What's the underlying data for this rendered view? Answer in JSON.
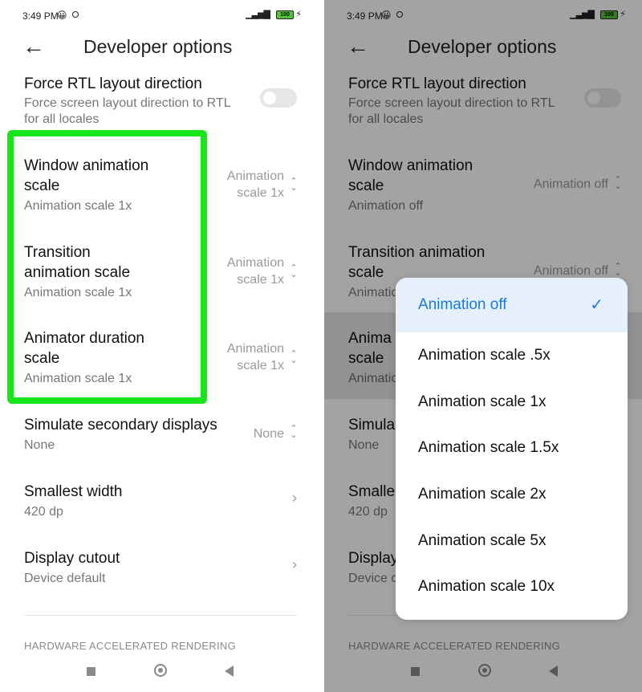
{
  "status": {
    "time": "3:49 PM",
    "battery": "100",
    "emoji": "😀"
  },
  "header": {
    "title": "Developer options",
    "back": "←"
  },
  "settings": {
    "rtl": {
      "title": "Force RTL layout direction",
      "subtitle_line1": "Force screen layout direction to RTL",
      "subtitle_line2": "for all locales"
    },
    "window": {
      "title_line1": "Window animation",
      "title_line2": "scale",
      "subtitle": "Animation scale 1x",
      "value_line1": "Animation",
      "value_line2": "scale 1x"
    },
    "transition": {
      "title_line1": "Transition",
      "title_line2": "animation scale",
      "subtitle": "Animation scale 1x",
      "value_line1": "Animation",
      "value_line2": "scale 1x"
    },
    "animator": {
      "title_line1": "Animator duration",
      "title_line2": "scale",
      "subtitle": "Animation scale 1x",
      "value_line1": "Animation",
      "value_line2": "scale 1x"
    },
    "secondary": {
      "title": "Simulate secondary displays",
      "subtitle": "None",
      "value": "None"
    },
    "smallest": {
      "title": "Smallest width",
      "subtitle": "420 dp"
    },
    "cutout": {
      "title": "Display cutout",
      "subtitle": "Device default"
    },
    "section_header": "HARDWARE ACCELERATED RENDERING"
  },
  "right_settings": {
    "window": {
      "title_line1": "Window animation",
      "title_line2": "scale",
      "subtitle": "Animation off",
      "value": "Animation off"
    },
    "transition": {
      "title_line1": "Transition animation",
      "title_line2": "scale",
      "subtitle": "Animatio",
      "value": "Animation off"
    },
    "animator": {
      "title_line1": "Anima",
      "title_line2": "scale",
      "subtitle": "Animatio"
    },
    "secondary": {
      "title": "Simula",
      "subtitle": "None"
    },
    "smallest": {
      "title": "Smalle",
      "subtitle": "420 dp"
    },
    "cutout": {
      "title": "Display",
      "subtitle": "Device d"
    }
  },
  "popup": {
    "options": [
      "Animation off",
      "Animation scale .5x",
      "Animation scale 1x",
      "Animation scale 1.5x",
      "Animation scale 2x",
      "Animation scale 5x",
      "Animation scale 10x"
    ],
    "selected": "Animation off"
  },
  "icons": {
    "check": "✓",
    "updown": "⌃⌄",
    "chevron": "›"
  },
  "colors": {
    "highlight": "#19e51b",
    "accent": "#1a7ad9"
  }
}
